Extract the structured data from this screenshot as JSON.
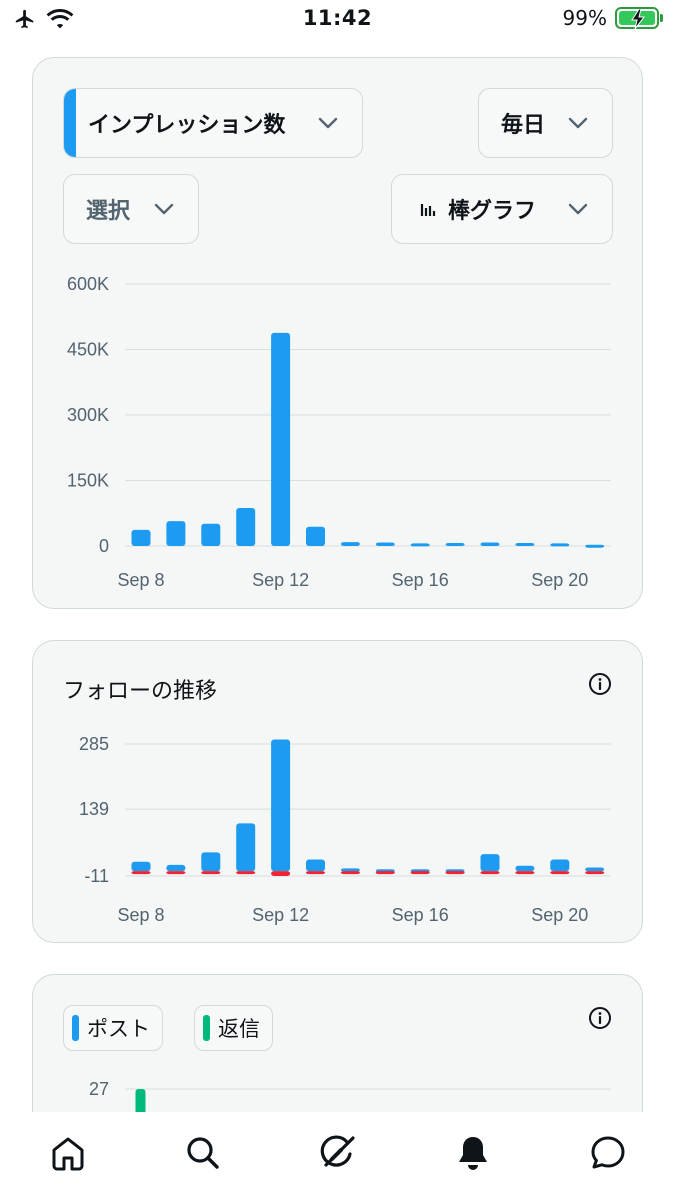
{
  "status_bar": {
    "time": "11:42",
    "battery_percent": "99%",
    "battery_level": 0.99,
    "icons": [
      "airplane-icon",
      "wifi-icon",
      "battery-charging-icon"
    ]
  },
  "impressions_card": {
    "metric_dropdown": "インプレッション数",
    "frequency_dropdown": "毎日",
    "select_dropdown": "選択",
    "chart_type_dropdown": "棒グラフ"
  },
  "follow_card": {
    "title": "フォローの推移"
  },
  "posts_card": {
    "legend": [
      {
        "label": "ポスト",
        "color": "#1d9bf0"
      },
      {
        "label": "返信",
        "color": "#00ba7c"
      }
    ]
  },
  "colors": {
    "accent": "#1d9bf0",
    "negative": "#f4212e",
    "reply": "#00ba7c"
  },
  "bottom_nav": [
    "home-icon",
    "search-icon",
    "grok-icon",
    "notifications-icon",
    "messages-icon"
  ],
  "chart_data": [
    {
      "type": "bar",
      "categories": [
        "Sep 8",
        "Sep 9",
        "Sep 10",
        "Sep 11",
        "Sep 12",
        "Sep 13",
        "Sep 14",
        "Sep 15",
        "Sep 16",
        "Sep 17",
        "Sep 18",
        "Sep 19",
        "Sep 20",
        "Sep 21"
      ],
      "values": [
        37000,
        57000,
        51000,
        87000,
        488000,
        44000,
        9000,
        8000,
        6000,
        7000,
        8000,
        7000,
        6000,
        3000
      ],
      "xlabel": "",
      "ylabel": "",
      "yticks": [
        "600K",
        "450K",
        "300K",
        "150K",
        "0"
      ],
      "ytick_values": [
        600000,
        450000,
        300000,
        150000,
        0
      ],
      "xticks": [
        "Sep 8",
        "Sep 12",
        "Sep 16",
        "Sep 20"
      ],
      "ylim": [
        0,
        600000
      ],
      "grid": true,
      "color": "#1d9bf0"
    },
    {
      "type": "bar",
      "categories": [
        "Sep 8",
        "Sep 9",
        "Sep 10",
        "Sep 11",
        "Sep 12",
        "Sep 13",
        "Sep 14",
        "Sep 15",
        "Sep 16",
        "Sep 17",
        "Sep 18",
        "Sep 19",
        "Sep 20",
        "Sep 21"
      ],
      "series": [
        {
          "values": [
            21,
            14,
            42,
            107,
            295,
            26,
            6,
            4,
            4,
            4,
            38,
            12,
            26,
            8
          ],
          "color": "#1d9bf0"
        },
        {
          "values": [
            -3,
            -5,
            -1,
            -1,
            -11,
            -6,
            -2,
            -1,
            -1,
            -1,
            -2,
            -2,
            -2,
            -1
          ],
          "color": "#f4212e"
        }
      ],
      "xlabel": "",
      "ylabel": "",
      "yticks": [
        "285",
        "139",
        "-11"
      ],
      "ytick_values": [
        285,
        139,
        -11
      ],
      "xticks": [
        "Sep 8",
        "Sep 12",
        "Sep 16",
        "Sep 20"
      ],
      "ylim": [
        -11,
        285
      ],
      "grid": true
    },
    {
      "type": "bar",
      "categories": [
        "Sep 8"
      ],
      "series": [
        {
          "name": "ポスト",
          "values": [
            0
          ],
          "color": "#1d9bf0"
        },
        {
          "name": "返信",
          "values": [
            27
          ],
          "color": "#00ba7c"
        }
      ],
      "yticks": [
        "27"
      ],
      "ytick_values": [
        27
      ],
      "ylim": [
        0,
        27
      ],
      "grid": true
    }
  ]
}
